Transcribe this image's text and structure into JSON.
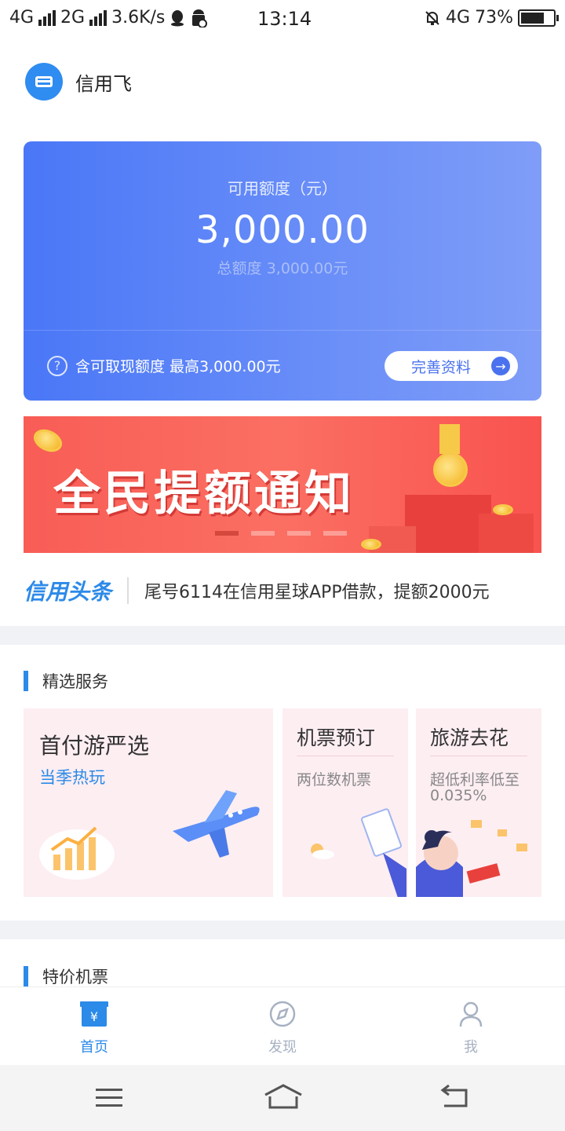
{
  "status_bar": {
    "net1": "4G",
    "net2": "2G",
    "speed": "3.6K/s",
    "time": "13:14",
    "net_right": "4G",
    "battery": "73%",
    "battery_level": 0.73
  },
  "header": {
    "app_name": "信用飞"
  },
  "credit": {
    "available_label": "可用额度（元）",
    "available_amount": "3,000.00",
    "total_label": "总额度 3,000.00元",
    "cash_note": "含可取现额度 最高3,000.00元",
    "complete_btn": "完善资料"
  },
  "banner": {
    "title": "全民提额通知",
    "active_index": 0,
    "total": 4
  },
  "headline": {
    "tag": "信用头条",
    "text": "尾号6114在信用星球APP借款，提额2000元"
  },
  "featured": {
    "title": "精选服务",
    "cards": [
      {
        "title": "首付游严选",
        "sub": "当季热玩"
      },
      {
        "title": "机票预订",
        "sub": "两位数机票"
      },
      {
        "title": "旅游去花",
        "sub": "超低利率低至",
        "sub2": "0.035%"
      }
    ]
  },
  "flights": {
    "title": "特价机票"
  },
  "tabs": [
    {
      "label": "首页",
      "active": true
    },
    {
      "label": "发现",
      "active": false
    },
    {
      "label": "我",
      "active": false
    }
  ],
  "colors": {
    "accent": "#2c8ae8",
    "card_start": "#4a77f7",
    "card_end": "#7f9df8",
    "banner": "#f85d56"
  }
}
